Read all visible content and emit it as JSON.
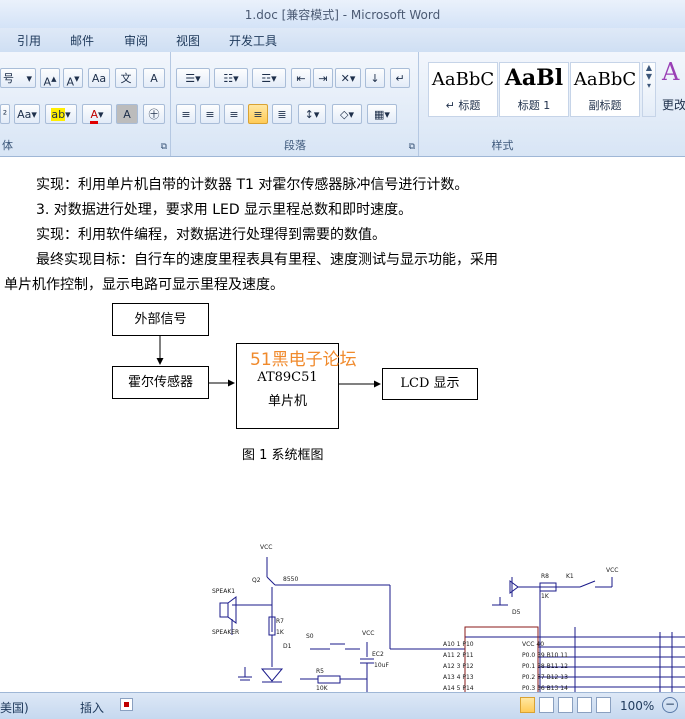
{
  "window": {
    "title": "1.doc [兼容模式] - Microsoft Word"
  },
  "tabs": [
    "引用",
    "邮件",
    "审阅",
    "视图",
    "开发工具"
  ],
  "ribbon": {
    "font_group": {
      "font_size_fragment": "号",
      "label_fragment": "体"
    },
    "paragraph_group": {
      "label": "段落"
    },
    "styles_group": {
      "label": "样式",
      "styles": [
        {
          "sample": "AaBbC",
          "name": "↵ 标题"
        },
        {
          "sample": "AaBl",
          "name": "标题 1"
        },
        {
          "sample": "AaBbC",
          "name": "副标题"
        }
      ],
      "change_styles_fragment": "更改"
    }
  },
  "document": {
    "lines": [
      "实现：利用单片机自带的计数器 T1 对霍尔传感器脉冲信号进行计数。",
      "3. 对数据进行处理，要求用 LED 显示里程总数和即时速度。",
      "实现：利用软件编程，对数据进行处理得到需要的数值。",
      "最终实现目标：自行车的速度里程表具有里程、速度测试与显示功能，采用",
      "单片机作控制，显示电路可显示里程及速度。"
    ],
    "diagram": {
      "ext_signal": "外部信号",
      "hall_sensor": "霍尔传感器",
      "mcu_line1": "AT89C51",
      "mcu_line2": "单片机",
      "lcd": "LCD 显示",
      "watermark": "51黑电子论坛",
      "caption": "图 1  系统框图"
    },
    "schematic": {
      "labels": [
        "VCC",
        "Q2",
        "8550",
        "SPEAK1",
        "SPEAKER",
        "R7",
        "1K",
        "D1",
        "S0",
        "VCC",
        "EC2",
        "10uF",
        "R5",
        "10K",
        "VCC",
        "R8",
        "1K",
        "K1",
        "D5"
      ],
      "pins_left": [
        "A10 1 P10",
        "A11 2 P11",
        "A12 3 P12",
        "A13 4 P13",
        "A14 5 P14"
      ],
      "pins_right": [
        "VCC 40",
        "P0.0 39  B10 11",
        "P0.1 38  B11 12",
        "P0.2 37  B12 13",
        "P0.3 36  B13 14"
      ]
    }
  },
  "status": {
    "lang": "美国)",
    "mode": "插入",
    "zoom": "100%"
  }
}
